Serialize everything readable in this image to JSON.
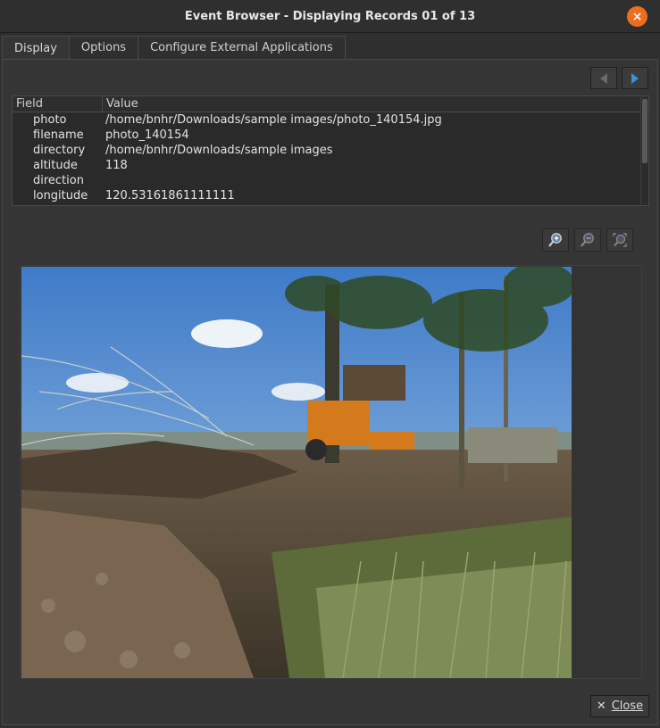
{
  "window": {
    "title": "Event Browser - Displaying Records 01 of 13",
    "close_icon": "×"
  },
  "tabs": [
    {
      "label": "Display",
      "active": true
    },
    {
      "label": "Options",
      "active": false
    },
    {
      "label": "Configure External Applications",
      "active": false
    }
  ],
  "table": {
    "headers": {
      "field": "Field",
      "value": "Value"
    },
    "rows": [
      {
        "field": "photo",
        "value": "/home/bnhr/Downloads/sample images/photo_140154.jpg"
      },
      {
        "field": "filename",
        "value": "photo_140154"
      },
      {
        "field": "directory",
        "value": "/home/bnhr/Downloads/sample images"
      },
      {
        "field": "altitude",
        "value": "118"
      },
      {
        "field": "direction",
        "value": ""
      },
      {
        "field": "longitude",
        "value": "120.53161861111111"
      }
    ]
  },
  "icons": {
    "prev": "chevron-left-icon",
    "next": "chevron-right-icon",
    "zoom_in": "zoom-in-icon",
    "zoom_out": "zoom-out-icon",
    "zoom_fit": "zoom-fit-icon"
  },
  "footer": {
    "close_label": "Close",
    "close_glyph": "✕"
  },
  "colors": {
    "accent": "#f06d1e",
    "nav_arrow_enabled": "#3d8fd6",
    "nav_arrow_disabled": "#6a6a6a"
  }
}
